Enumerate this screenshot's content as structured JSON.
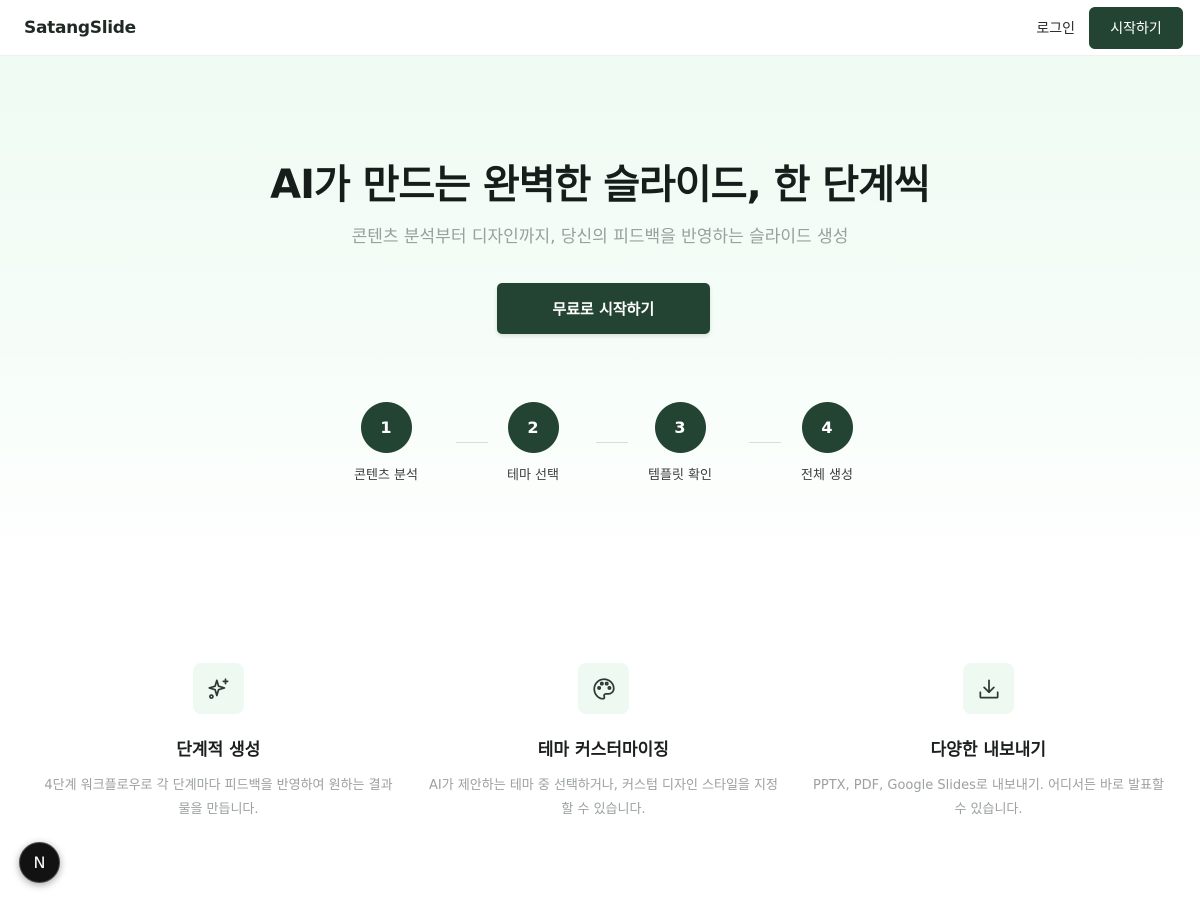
{
  "header": {
    "logo": "SatangSlide",
    "login_label": "로그인",
    "start_label": "시작하기"
  },
  "hero": {
    "title": "AI가 만드는 완벽한 슬라이드, 한 단계씩",
    "subtitle": "콘텐츠 분석부터 디자인까지, 당신의 피드백을 반영하는 슬라이드 생성",
    "cta_label": "무료로 시작하기"
  },
  "steps": [
    {
      "number": "1",
      "label": "콘텐츠 분석"
    },
    {
      "number": "2",
      "label": "테마 선택"
    },
    {
      "number": "3",
      "label": "템플릿 확인"
    },
    {
      "number": "4",
      "label": "전체 생성"
    }
  ],
  "features": [
    {
      "icon": "sparkles-icon",
      "title": "단계적 생성",
      "desc": "4단계 워크플로우로 각 단계마다 피드백을 반영하여 원하는 결과물을 만듭니다."
    },
    {
      "icon": "palette-icon",
      "title": "테마 커스터마이징",
      "desc": "AI가 제안하는 테마 중 선택하거나, 커스텀 디자인 스타일을 지정할 수 있습니다."
    },
    {
      "icon": "download-icon",
      "title": "다양한 내보내기",
      "desc": "PPTX, PDF, Google Slides로 내보내기. 어디서든 바로 발표할 수 있습니다."
    }
  ],
  "floating_badge": "N",
  "colors": {
    "primary": "#234333",
    "hero_bg": "#effbf3",
    "icon_bg": "#eefaf1"
  }
}
